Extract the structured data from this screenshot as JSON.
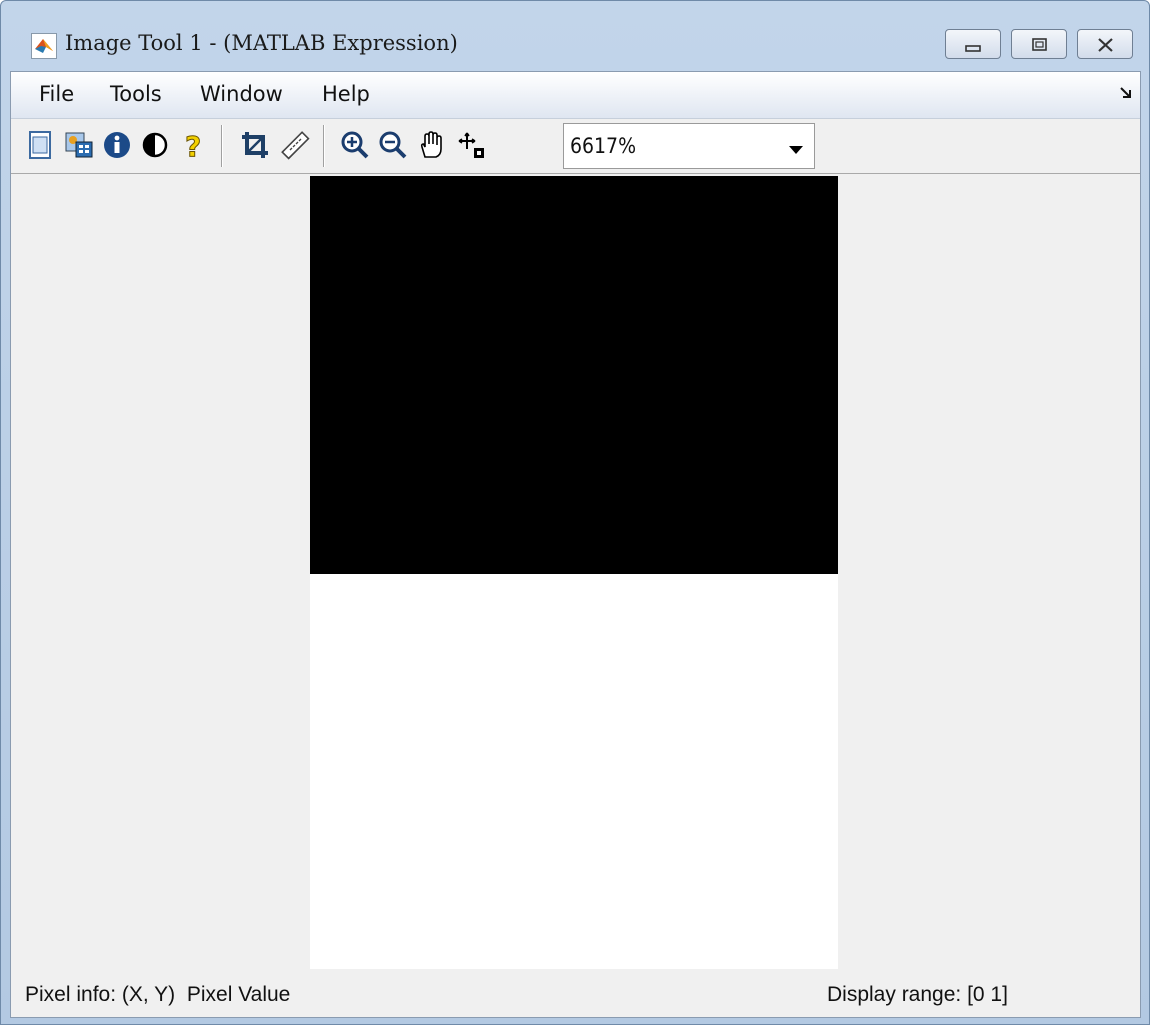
{
  "window": {
    "title": "Image Tool 1 - (MATLAB Expression)",
    "icon": "matlab-logo-icon"
  },
  "title_buttons": [
    "minimize-icon",
    "maximize-icon",
    "close-icon"
  ],
  "menu": {
    "file": "File",
    "tools": "Tools",
    "window": "Window",
    "help": "Help"
  },
  "toolbar": {
    "icons": [
      "new-figure-icon",
      "image-info-icon",
      "info-icon",
      "contrast-icon",
      "help-icon",
      "crop-icon",
      "measure-distance-icon",
      "zoom-in-icon",
      "zoom-out-icon",
      "pan-hand-icon",
      "pixel-region-icon"
    ],
    "zoom_value": "6617%"
  },
  "image": {
    "pixels": [
      "black",
      "white"
    ],
    "colors": {
      "top": "#000000",
      "bottom": "#ffffff"
    }
  },
  "status": {
    "pixel_info": "Pixel info: (X, Y)  Pixel Value",
    "display_range": "Display range: [0 1]"
  },
  "colors": {
    "titlebar": "#b9cde5",
    "panel": "#f0f0f0"
  }
}
